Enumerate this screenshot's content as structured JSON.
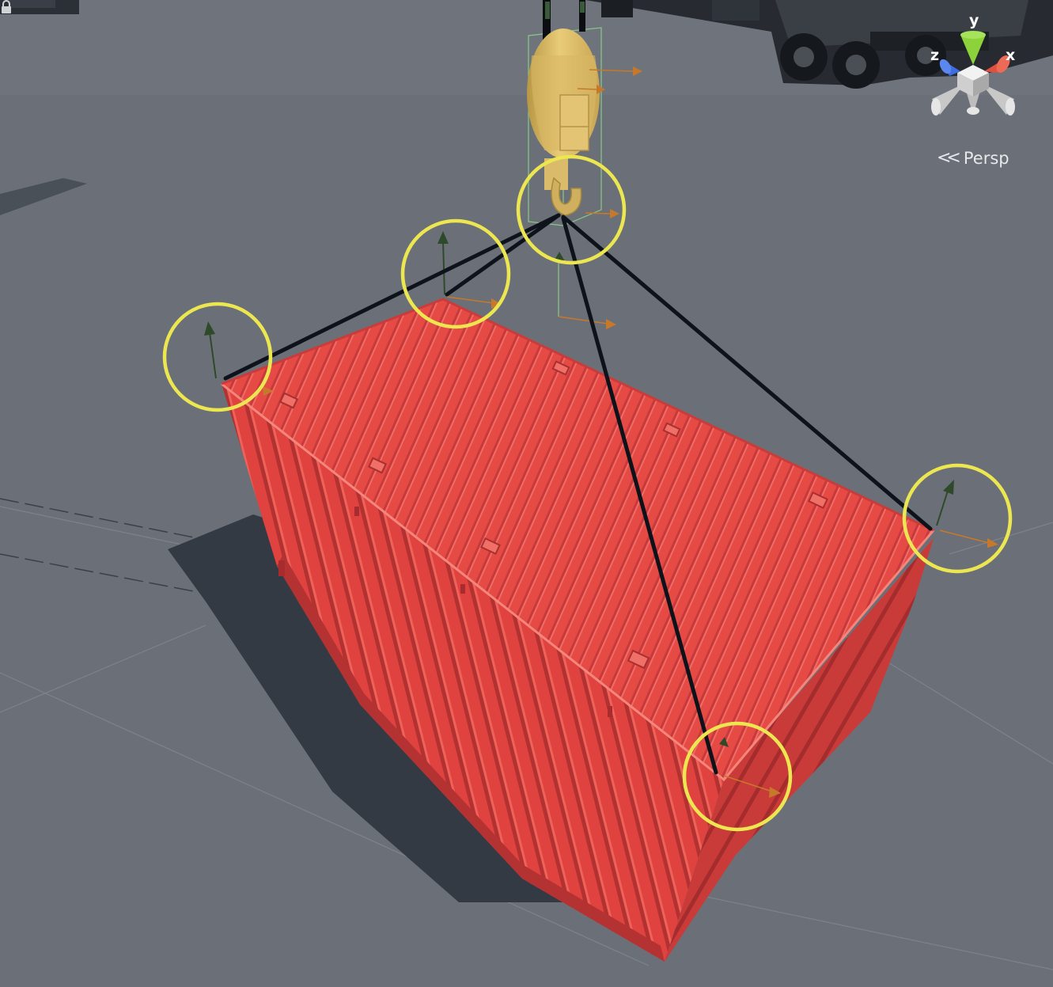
{
  "scene_view": {
    "projection_label": "Persp",
    "axis_gizmo": {
      "y_label": "y",
      "x_label": "x",
      "z_label": "z",
      "colors": {
        "y": "#8cd23a",
        "x": "#e0503c",
        "z": "#3c6ee0",
        "center": "#d8d8d8"
      }
    },
    "icons": {
      "lock": "lock-icon",
      "persp_chevron": "chevron-left-icon"
    }
  },
  "scene": {
    "container_color": "#e84a45",
    "hook_color": "#dcb860",
    "highlight_color": "#ece650",
    "rope_color": "#0e121a",
    "ground_color": "#6b7078",
    "shadow_color": "#343a44"
  }
}
